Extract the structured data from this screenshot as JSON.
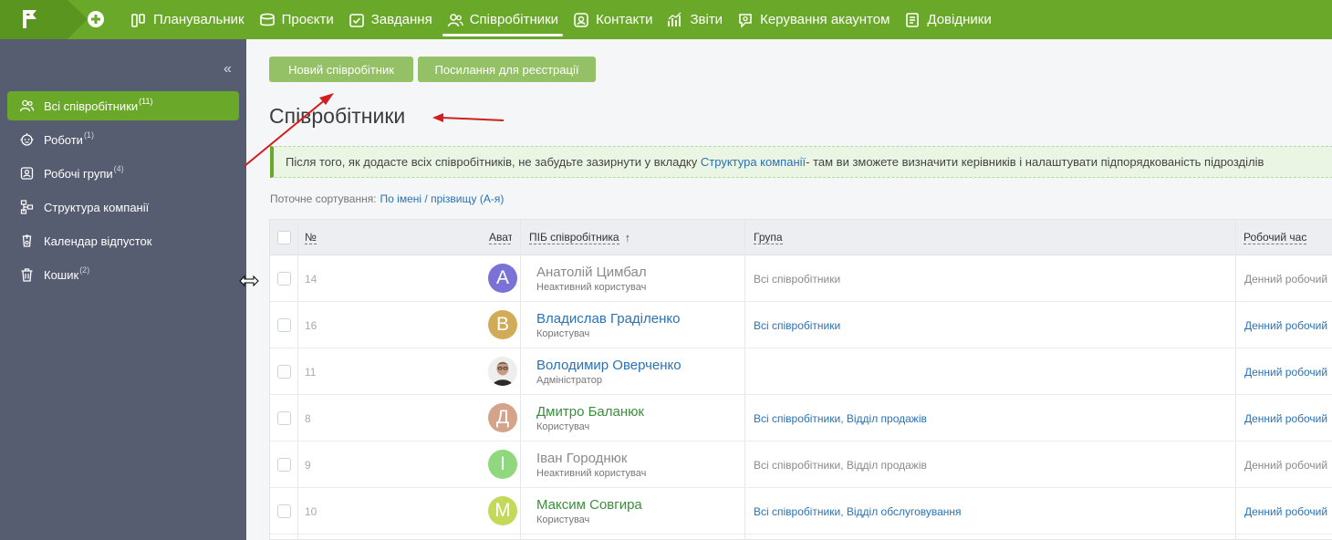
{
  "nav": [
    {
      "label": "Планувальник",
      "icon": "planner-icon"
    },
    {
      "label": "Проєкти",
      "icon": "projects-icon"
    },
    {
      "label": "Завдання",
      "icon": "tasks-icon"
    },
    {
      "label": "Співробітники",
      "icon": "employees-icon",
      "active": true
    },
    {
      "label": "Контакти",
      "icon": "contacts-icon"
    },
    {
      "label": "Звіти",
      "icon": "reports-icon"
    },
    {
      "label": "Керування акаунтом",
      "icon": "account-icon"
    },
    {
      "label": "Довідники",
      "icon": "directories-icon"
    }
  ],
  "sidebar": {
    "items": [
      {
        "label": "Всі співробітники",
        "count": "(11)",
        "active": true,
        "icon": "people-icon"
      },
      {
        "label": "Роботи",
        "count": "(1)",
        "icon": "robot-icon"
      },
      {
        "label": "Робочі групи",
        "count": "(4)",
        "icon": "group-icon"
      },
      {
        "label": "Структура компанії",
        "count": "",
        "icon": "structure-icon"
      },
      {
        "label": "Календар відпусток",
        "count": "",
        "icon": "vacation-icon"
      },
      {
        "label": "Кошик",
        "count": "(2)",
        "icon": "trash-icon"
      }
    ]
  },
  "buttons": {
    "new_employee": "Новий співробітник",
    "registration_link": "Посилання для реєстрації"
  },
  "page_title": "Співробітники",
  "info": {
    "before": "Після того, як додасте всіх співробітників, не забудьте зазирнути у вкладку ",
    "link": "Структура компанії",
    "after": " - там ви зможете визначити керівників і налаштувати підпорядкованість підрозділів"
  },
  "sort": {
    "label": "Поточне сортування:",
    "value": "По імені / прізвищу (А-я)"
  },
  "table": {
    "headers": {
      "num": "№",
      "avatar": "Аватар",
      "name": "ПІБ співробітника",
      "group": "Група",
      "work_time": "Робочий час"
    },
    "rows": [
      {
        "num": "14",
        "initial": "А",
        "avatar_color": "#7b72d8",
        "name": "Анатолій Цимбал",
        "role": "Неактивний користувач",
        "group": "Всі співробітники",
        "work_time": "Денний робочий",
        "inactive": true
      },
      {
        "num": "16",
        "initial": "В",
        "avatar_color": "#d2ab59",
        "name": "Владислав Граділенко",
        "role": "Користувач",
        "group": "Всі співробітники",
        "work_time": "Денний робочий",
        "name_color": "#2a72b5"
      },
      {
        "num": "11",
        "initial": "",
        "avatar_color": "#6e6e6e",
        "name": "Володимир Оверченко",
        "role": "Адміністратор",
        "group": "",
        "work_time": "Денний робочий",
        "name_color": "#2a72b5",
        "photo": true
      },
      {
        "num": "8",
        "initial": "Д",
        "avatar_color": "#d4a48a",
        "name": "Дмитро Баланюк",
        "role": "Користувач",
        "group": "Всі співробітники, Відділ продажів",
        "work_time": "Денний робочий",
        "name_color": "#3a8f3a"
      },
      {
        "num": "9",
        "initial": "І",
        "avatar_color": "#8fd87e",
        "name": "Іван Городнюк",
        "role": "Неактивний користувач",
        "group": "Всі співробітники, Відділ продажів",
        "work_time": "Денний робочий",
        "inactive": true
      },
      {
        "num": "10",
        "initial": "М",
        "avatar_color": "#c4d85a",
        "name": "Максим Совгира",
        "role": "Користувач",
        "group": "Всі співробітники, Відділ обслуговування",
        "work_time": "Денний робочий",
        "name_color": "#3a8f3a"
      }
    ]
  },
  "colors": {
    "accent": "#6aa82a",
    "sidebar": "#575d70",
    "link": "#2a72b5",
    "annotation_arrow": "#d11f1f"
  }
}
